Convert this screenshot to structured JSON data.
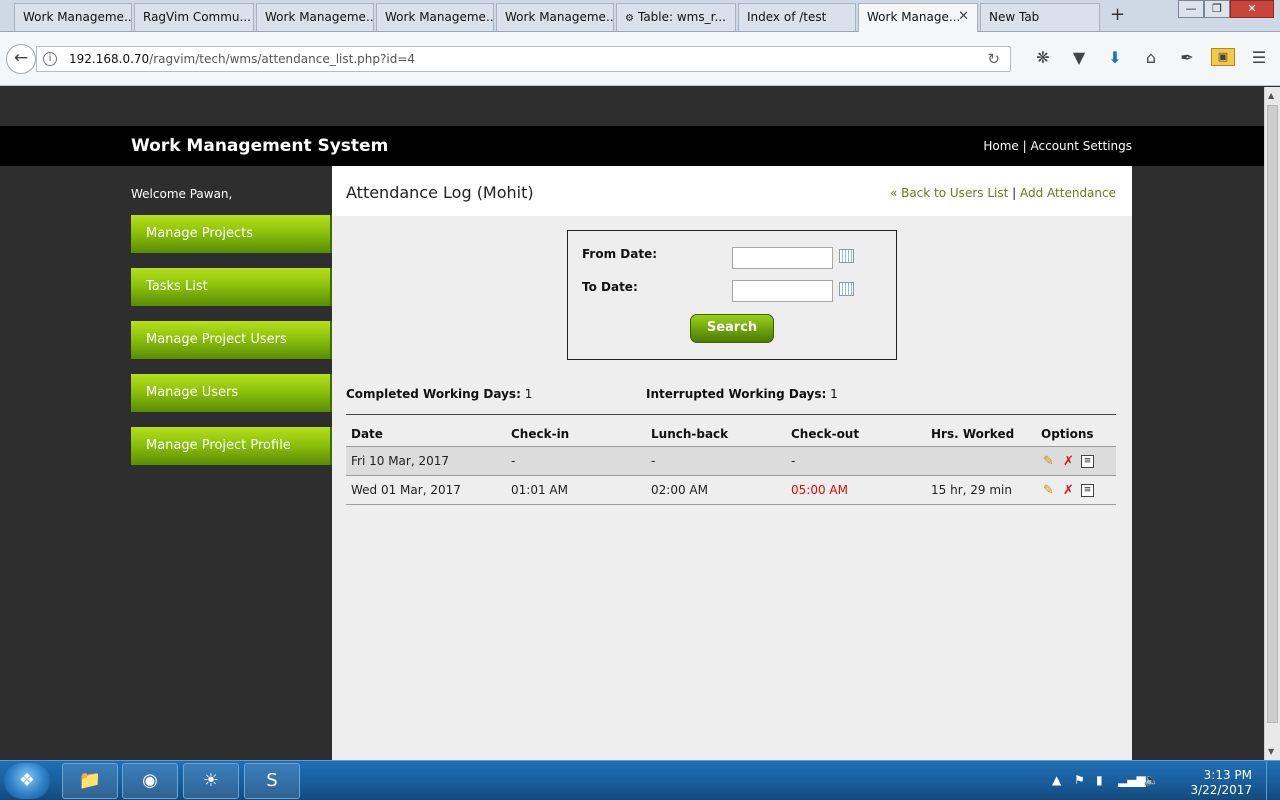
{
  "browser": {
    "tabs": [
      {
        "label": "Work Manageme..."
      },
      {
        "label": "RagVim Commu..."
      },
      {
        "label": "Work Manageme..."
      },
      {
        "label": "Work Manageme..."
      },
      {
        "label": "Work Manageme..."
      },
      {
        "label": "Table: wms_r..."
      },
      {
        "label": "Index of /test"
      },
      {
        "label": "Work Manage..."
      },
      {
        "label": "New Tab"
      }
    ],
    "url_host": "192.168.0.70",
    "url_path": "/ragvim/tech/wms/attendance_list.php?id=4"
  },
  "site": {
    "title": "Work Management System",
    "nav": {
      "home": "Home",
      "separator": "|",
      "account": "Account Settings"
    }
  },
  "sidebar": {
    "welcome": "Welcome Pawan,",
    "items": [
      {
        "label": "Manage Projects"
      },
      {
        "label": "Tasks List"
      },
      {
        "label": "Manage Project Users"
      },
      {
        "label": "Manage Users"
      },
      {
        "label": "Manage Project Profile"
      }
    ]
  },
  "main": {
    "heading": "Attendance Log (Mohit)",
    "back_link": "« Back to Users List",
    "separator": "|",
    "add_link": "Add Attendance",
    "form": {
      "from_label": "From Date:",
      "to_label": "To Date:",
      "from_value": "",
      "to_value": "",
      "search_label": "Search"
    },
    "summary": {
      "completed_label": "Completed Working Days:",
      "completed_value": "1",
      "interrupted_label": "Interrupted Working Days:",
      "interrupted_value": "1"
    },
    "table": {
      "headers": [
        "Date",
        "Check-in",
        "Lunch-back",
        "Check-out",
        "Hrs. Worked",
        "Options"
      ],
      "rows": [
        {
          "date": "Fri 10 Mar, 2017",
          "checkin": "-",
          "lunch": "-",
          "checkout": "-",
          "hours": ""
        },
        {
          "date": "Wed 01 Mar, 2017",
          "checkin": "01:01 AM",
          "lunch": "02:00 AM",
          "checkout": "05:00 AM",
          "hours": "15 hr, 29 min"
        }
      ],
      "checkout_alert_color": "#e00a0a"
    }
  },
  "taskbar": {
    "clock_time": "3:13 PM",
    "clock_date": "3/22/2017"
  },
  "colors": {
    "accent_green": "#8cc20c",
    "link_olive": "#6c7a1e",
    "header_black": "#000000"
  }
}
